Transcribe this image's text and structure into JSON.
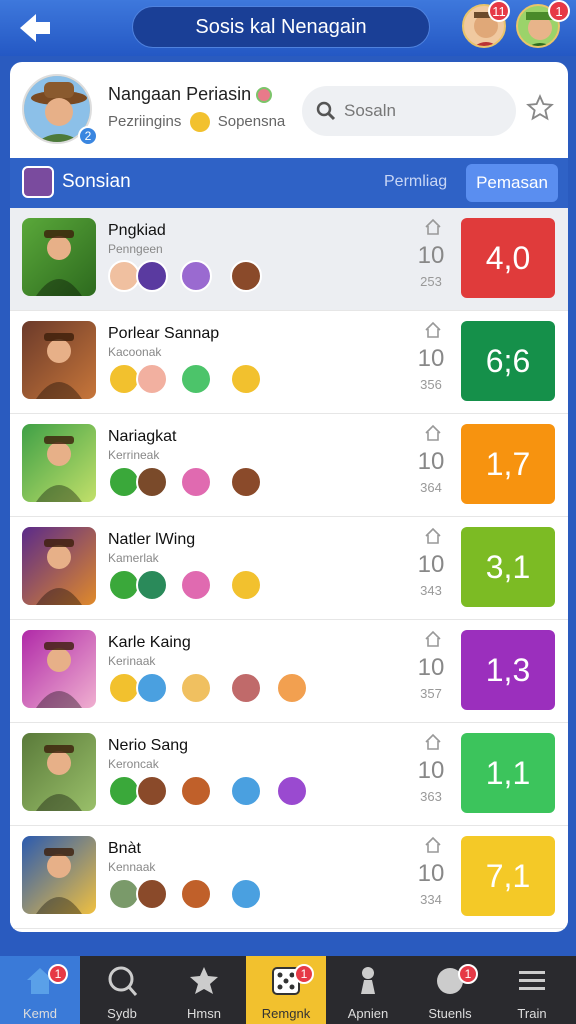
{
  "header": {
    "title": "Sosis kal Nenagain",
    "avatar_badge_1": "11",
    "avatar_badge_2": "1"
  },
  "profile": {
    "name": "Nangaan Periasin",
    "subtitle": "Pezriingins",
    "subtitle_2": "Sopensna",
    "avatar_badge": "2",
    "search_placeholder": "Sosaln"
  },
  "section": {
    "title": "Sonsian",
    "link": "Permliag",
    "button": "Pemasan"
  },
  "rows": [
    {
      "name": "Pngkiad",
      "sub": "Penngeen",
      "count": "10",
      "num": "253",
      "score": "4,0",
      "color": "#e03b3b",
      "selected": true
    },
    {
      "name": "Porlear Sannap",
      "sub": "Kacoonak",
      "count": "10",
      "num": "356",
      "score": "6;6",
      "color": "#15904a",
      "selected": false
    },
    {
      "name": "Nariagkat",
      "sub": "Kerrineak",
      "count": "10",
      "num": "364",
      "score": "1,7",
      "color": "#f7930f",
      "selected": false
    },
    {
      "name": "Natler lWing",
      "sub": "Kamerlak",
      "count": "10",
      "num": "343",
      "score": "3,1",
      "color": "#7cbb24",
      "selected": false
    },
    {
      "name": "Karle Kaing",
      "sub": "Kerinaak",
      "count": "10",
      "num": "357",
      "score": "1,3",
      "color": "#9b2fbd",
      "selected": false
    },
    {
      "name": "Nerio Sang",
      "sub": "Keroncak",
      "count": "10",
      "num": "363",
      "score": "1,1",
      "color": "#3cc45c",
      "selected": false
    },
    {
      "name": "Bnàt",
      "sub": "Kennaak",
      "count": "10",
      "num": "334",
      "score": "7,1",
      "color": "#f4c927",
      "selected": false
    }
  ],
  "nav": [
    {
      "label": "Kemd",
      "badge": "1",
      "icon": "home-icon"
    },
    {
      "label": "Sydb",
      "badge": "",
      "icon": "search-icon"
    },
    {
      "label": "Hmsn",
      "badge": "",
      "icon": "star-icon"
    },
    {
      "label": "Remgnk",
      "badge": "1",
      "icon": "dice-icon"
    },
    {
      "label": "Apnien",
      "badge": "",
      "icon": "pawn-icon"
    },
    {
      "label": "Stuenls",
      "badge": "1",
      "icon": "ball-icon"
    },
    {
      "label": "Train",
      "badge": "",
      "icon": "menu-icon"
    }
  ]
}
